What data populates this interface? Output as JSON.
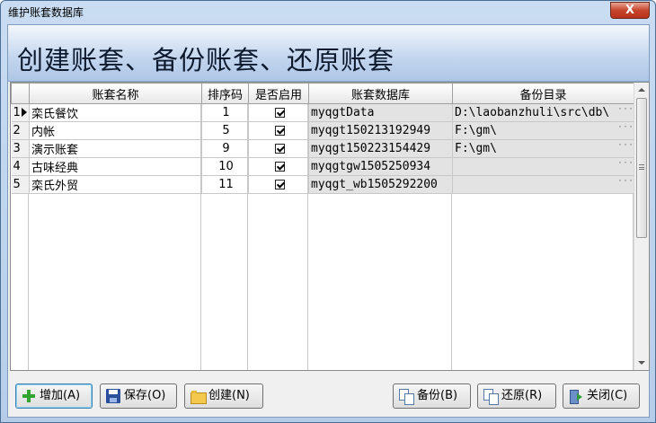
{
  "window": {
    "title": "维护账套数据库",
    "close_glyph": "X"
  },
  "header": {
    "title": "创建账套、备份账套、还原账套"
  },
  "grid": {
    "columns": [
      "账套名称",
      "排序码",
      "是否启用",
      "账套数据库",
      "备份目录"
    ],
    "rows": [
      {
        "num": "1",
        "name": "栾氏餐饮",
        "order": "1",
        "enabled": true,
        "db": "myqgtData",
        "backup": "D:\\laobanzhuli\\src\\db\\"
      },
      {
        "num": "2",
        "name": "内帐",
        "order": "5",
        "enabled": true,
        "db": "myqgt150213192949",
        "backup": "F:\\gm\\"
      },
      {
        "num": "3",
        "name": "演示账套",
        "order": "9",
        "enabled": true,
        "db": "myqgt150223154429",
        "backup": "F:\\gm\\"
      },
      {
        "num": "4",
        "name": "古味经典",
        "order": "10",
        "enabled": true,
        "db": "myqgtgw1505250934",
        "backup": ""
      },
      {
        "num": "5",
        "name": "栾氏外贸",
        "order": "11",
        "enabled": true,
        "db": "myqgt_wb1505292200",
        "backup": ""
      }
    ],
    "ellipsis": "···"
  },
  "buttons": {
    "add": "增加(A)",
    "save": "保存(O)",
    "create": "创建(N)",
    "backup": "备份(B)",
    "restore": "还原(R)",
    "close": "关闭(C)"
  },
  "icons": [
    "add-icon",
    "save-icon",
    "folder-icon",
    "backup-icon",
    "restore-icon",
    "exit-icon",
    "check-icon",
    "row-pointer-icon"
  ],
  "colors": {
    "title_bar": "#c9dcf2",
    "close_button": "#c7452d",
    "header_gradient_end": "#aec6e6",
    "focus_border": "#3c7fb1"
  }
}
